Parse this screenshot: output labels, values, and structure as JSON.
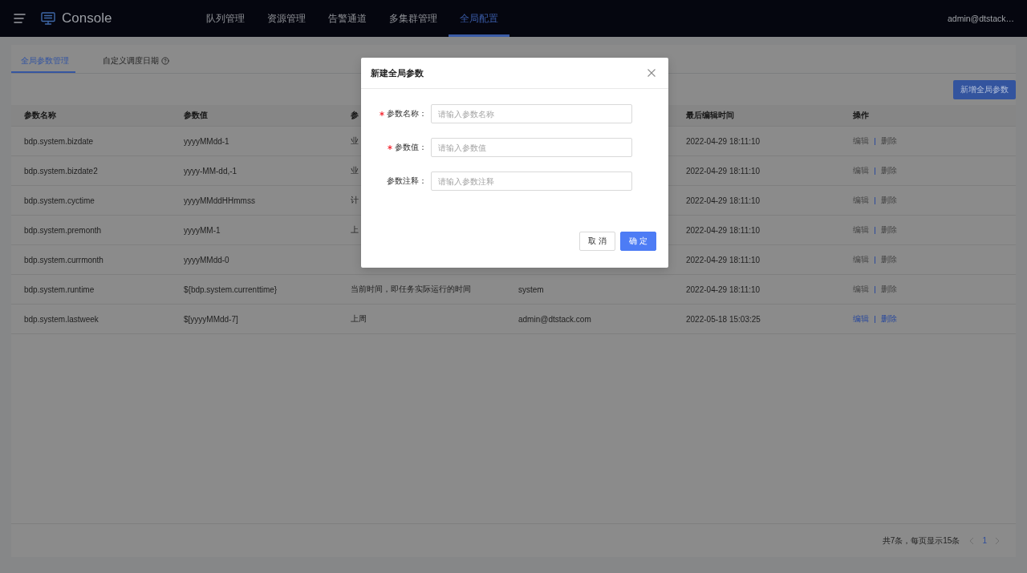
{
  "header": {
    "logo": "Console",
    "nav": [
      {
        "label": "队列管理",
        "selected": false
      },
      {
        "label": "资源管理",
        "selected": false
      },
      {
        "label": "告警通道",
        "selected": false
      },
      {
        "label": "多集群管理",
        "selected": false
      },
      {
        "label": "全局配置",
        "selected": true
      }
    ],
    "user": "admin@dtstack…"
  },
  "tabs": [
    {
      "label": "全局参数管理",
      "selected": true,
      "help": false
    },
    {
      "label": "自定义调度日期",
      "selected": false,
      "help": true
    }
  ],
  "toolbar": {
    "add_button": "新增全局参数"
  },
  "table": {
    "columns": {
      "name": "参数名称",
      "value": "参数值",
      "column_3": "参",
      "edited_at": "最后编辑时间",
      "actions": "操作"
    },
    "rows": [
      {
        "name": "bdp.system.bizdate",
        "value": "yyyyMMdd-1",
        "column_3": "业",
        "edited_at": "2022-04-29 18:11:10",
        "actions": [
          {
            "label": "编辑",
            "disabled": true
          },
          {
            "label": "删除",
            "disabled": true
          }
        ]
      },
      {
        "name": "bdp.system.bizdate2",
        "value": "yyyy-MM-dd,-1",
        "column_3": "业",
        "edited_at": "2022-04-29 18:11:10",
        "actions": [
          {
            "label": "编辑",
            "disabled": true
          },
          {
            "label": "删除",
            "disabled": true
          }
        ]
      },
      {
        "name": "bdp.system.cyctime",
        "value": "yyyyMMddHHmmss",
        "column_3": "计",
        "edited_at": "2022-04-29 18:11:10",
        "actions": [
          {
            "label": "编辑",
            "disabled": true
          },
          {
            "label": "删除",
            "disabled": true
          }
        ]
      },
      {
        "name": "bdp.system.premonth",
        "value": "yyyyMM-1",
        "column_3": "上",
        "edited_at": "2022-04-29 18:11:10",
        "actions": [
          {
            "label": "编辑",
            "disabled": true
          },
          {
            "label": "删除",
            "disabled": true
          }
        ]
      },
      {
        "name": "bdp.system.currmonth",
        "value": "yyyyMMdd-0",
        "edited_at": "2022-04-29 18:11:10",
        "actions": [
          {
            "label": "编辑",
            "disabled": true
          },
          {
            "label": "删除",
            "disabled": true
          }
        ]
      },
      {
        "name": "bdp.system.runtime",
        "value": "${bdp.system.currenttime}",
        "column_3": "当前时间，即任务实际运行的时间",
        "column_4": "system",
        "edited_at": "2022-04-29 18:11:10",
        "actions": [
          {
            "label": "编辑",
            "disabled": true
          },
          {
            "label": "删除",
            "disabled": true
          }
        ]
      },
      {
        "name": "bdp.system.lastweek",
        "value": "$[yyyyMMdd-7]",
        "column_3": "上周",
        "column_4": "admin@dtstack.com",
        "edited_at": "2022-05-18 15:03:25",
        "actions": [
          {
            "label": "编辑",
            "disabled": false
          },
          {
            "label": "删除",
            "disabled": false
          }
        ]
      }
    ]
  },
  "pagination": {
    "summary": "共7条，每页显示15条",
    "pages": [
      {
        "label": "1",
        "selected": true
      }
    ]
  },
  "modal": {
    "title": "新建全局参数",
    "fields": [
      {
        "label": "参数名称：",
        "required": true,
        "placeholder": "请输入参数名称"
      },
      {
        "label": "参数值：",
        "required": true,
        "placeholder": "请输入参数值"
      },
      {
        "label": "参数注释：",
        "required": false,
        "placeholder": "请输入参数注释"
      }
    ],
    "buttons": [
      {
        "label": "取 消",
        "kind": "default"
      },
      {
        "label": "确 定",
        "kind": "primary"
      }
    ]
  }
}
